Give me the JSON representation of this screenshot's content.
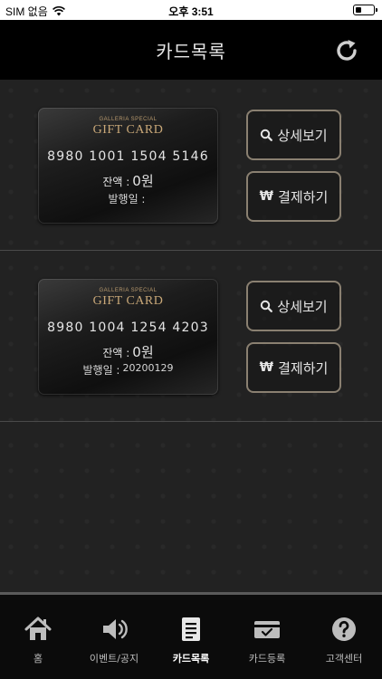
{
  "status_bar": {
    "carrier": "SIM 없음",
    "time": "오후 3:51"
  },
  "header": {
    "title": "카드목록",
    "refresh_icon": "refresh-icon"
  },
  "cards": [
    {
      "brand_small": "GALLERIA SPECIAL",
      "brand_big": "GIFT CARD",
      "number": "8980 1001 1504 5146",
      "balance_label": "잔액 :",
      "balance_value": "0원",
      "issue_label": "발행일 :",
      "issue_date": "",
      "detail_label": "상세보기",
      "pay_label": "결제하기"
    },
    {
      "brand_small": "GALLERIA SPECIAL",
      "brand_big": "GIFT CARD",
      "number": "8980 1004 1254 4203",
      "balance_label": "잔액 :",
      "balance_value": "0원",
      "issue_label": "발행일 :",
      "issue_date": "20200129",
      "detail_label": "상세보기",
      "pay_label": "결제하기"
    }
  ],
  "tabs": [
    {
      "label": "홈",
      "icon": "home-icon",
      "active": false
    },
    {
      "label": "이벤트/공지",
      "icon": "speaker-icon",
      "active": false
    },
    {
      "label": "카드목록",
      "icon": "list-icon",
      "active": true
    },
    {
      "label": "카드등록",
      "icon": "card-register-icon",
      "active": false
    },
    {
      "label": "고객센터",
      "icon": "help-icon",
      "active": false
    }
  ],
  "colors": {
    "header_bg": "#000000",
    "content_bg": "#222222",
    "button_border": "#8a8071",
    "card_gold": "#c9a878"
  }
}
